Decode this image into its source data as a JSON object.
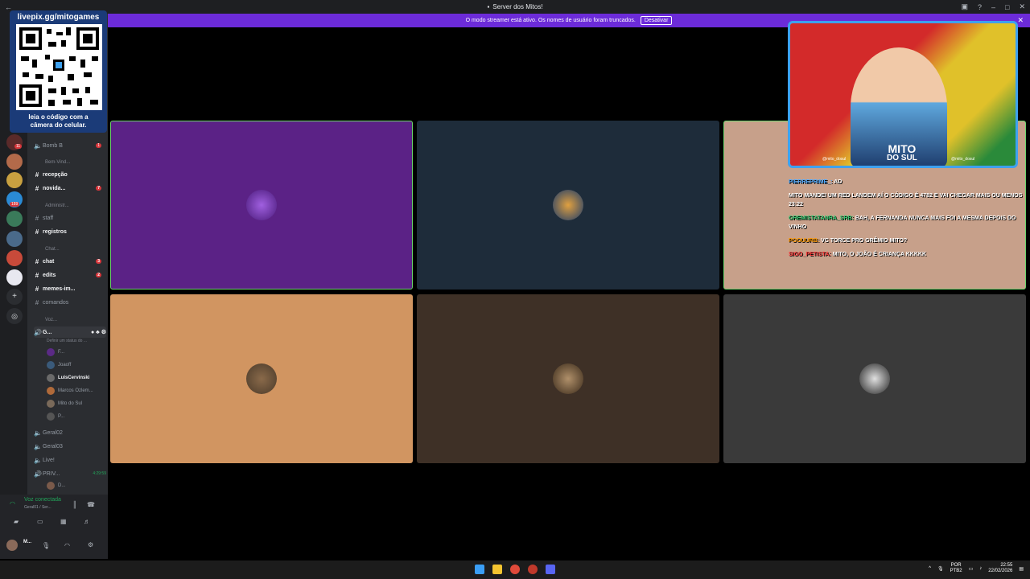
{
  "window": {
    "title": "Server dos Mitos!"
  },
  "banner": {
    "message": "O modo streamer está ativo. Os nomes de usuário foram truncados.",
    "disable_label": "Desativar"
  },
  "qr_overlay": {
    "url": "livepix.gg/mitogames",
    "caption_line1": "leia o código com a",
    "caption_line2": "câmera do celular."
  },
  "server_rail": {
    "badges": [
      "11",
      "189"
    ]
  },
  "channels": [
    {
      "label": "Bomb B",
      "type": "voice",
      "badge": "1"
    },
    {
      "label": "Bem-Vind...",
      "type": "category"
    },
    {
      "label": "recepção",
      "type": "text",
      "bold": true
    },
    {
      "label": "novida...",
      "type": "text",
      "bold": true,
      "badge": "7"
    },
    {
      "label": "Administr...",
      "type": "category"
    },
    {
      "label": "staff",
      "type": "text"
    },
    {
      "label": "registros",
      "type": "text",
      "bold": true
    },
    {
      "label": "Chat...",
      "type": "category"
    },
    {
      "label": "chat",
      "type": "text",
      "bold": true,
      "badge": "3"
    },
    {
      "label": "edits",
      "type": "text",
      "bold": true,
      "badge": "2"
    },
    {
      "label": "memes-im...",
      "type": "text",
      "bold": true
    },
    {
      "label": "comandos",
      "type": "text"
    },
    {
      "label": "Voz...",
      "type": "category"
    },
    {
      "label": "G...",
      "type": "voice",
      "bold": true
    }
  ],
  "voice_status_hint": "Definir um status do ...",
  "voice_users": [
    {
      "name": "F...",
      "color": "#5b2a86"
    },
    {
      "name": "Joaoff",
      "color": "#3a5a7a"
    },
    {
      "name": "LuisCervinski",
      "color": "#6a6a6a",
      "bold": true
    },
    {
      "name": "Marcos Ozlem...",
      "color": "#b06a3a"
    },
    {
      "name": "Mito do Sul",
      "color": "#7a6a5a"
    },
    {
      "name": "P...",
      "color": "#555555"
    }
  ],
  "more_channels": [
    {
      "label": "Geral02"
    },
    {
      "label": "Geral03"
    },
    {
      "label": "Live!"
    },
    {
      "label": "PRIV...",
      "time": "4:29:59"
    }
  ],
  "more_users": [
    {
      "name": "D..."
    }
  ],
  "voice_panel": {
    "status": "Voz conectada",
    "sub": "Geral01 / Ser...",
    "user": "M..."
  },
  "chat_messages": [
    {
      "user": "PIERREPRIME_:",
      "text": "AD",
      "user_color": "#4aa8ff"
    },
    {
      "user": "",
      "text": "MITO MANDEI UM RED LANDEM AÍ O CÓDIGO É 4782 E VAI CHEGAR MAIS OU MENOS 23:22",
      "user_color": "#ff6a3a"
    },
    {
      "user": "GREMISTATANRA_SRB:",
      "text": "BAH, A FERNANDA NUNCA MAIS FOI A MESMA DEPOIS DO VINHO",
      "user_color": "#2ecc71"
    },
    {
      "user": "POOUURB:",
      "text": "VC TORCE PRO GRÊMIO MITO?",
      "user_color": "#ff9a00"
    },
    {
      "user": "SIGO_PETISTA:",
      "text": "MITO, O JOÃO É CRIANÇA KKKKK",
      "user_color": "#ff3a3a"
    }
  ],
  "cam": {
    "logo_line1": "MITO",
    "logo_line2": "DO SUL",
    "handle_left": "@mito_dosul",
    "handle_right": "@mito_dosul"
  },
  "taskbar": {
    "lang1": "POR",
    "lang2": "PTB2",
    "time": "22:55",
    "date": "22/02/2026"
  }
}
